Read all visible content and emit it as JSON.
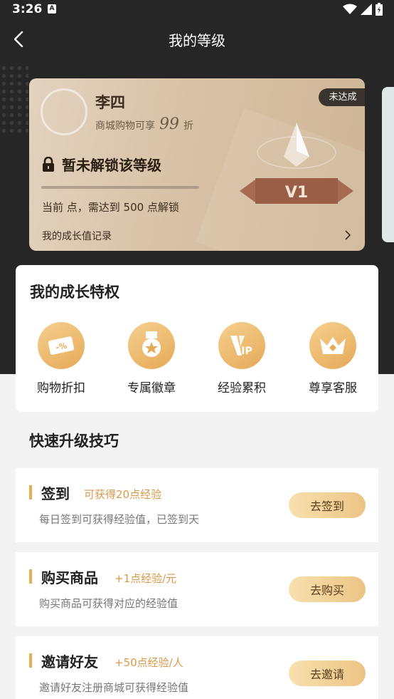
{
  "status_bar": {
    "time": "3:26",
    "notif_letter": "A"
  },
  "header": {
    "title": "我的等级"
  },
  "level_card": {
    "user_name": "李四",
    "discount_prefix": "商城购物可享",
    "discount_value": "99",
    "discount_suffix": "折",
    "badge": "未达成",
    "lock_text": "暂未解锁该等级",
    "unlock_hint": "当前  点，需达到 500 点解锁",
    "record_link": "我的成长值记录",
    "level_label": "V1",
    "progress": 0
  },
  "privileges": {
    "title": "我的成长特权",
    "items": [
      {
        "label": "购物折扣",
        "icon": "discount-icon"
      },
      {
        "label": "专属徽章",
        "icon": "badge-icon"
      },
      {
        "label": "经验累积",
        "icon": "vip-icon"
      },
      {
        "label": "尊享客服",
        "icon": "crown-icon"
      }
    ]
  },
  "tips": {
    "title": "快速升级技巧",
    "items": [
      {
        "title": "签到",
        "reward": "可获得20点经验",
        "desc": "每日签到可获得经验值，已签到天",
        "button": "去签到"
      },
      {
        "title": "购买商品",
        "reward": "+1点经验/元",
        "desc": "购买商品可获得对应的经验值",
        "button": "去购买"
      },
      {
        "title": "邀请好友",
        "reward": "+50点经验/人",
        "desc": "邀请好友注册商城可获得经验值",
        "button": "去邀请"
      }
    ]
  },
  "colors": {
    "dark_bg": "#262626",
    "gold_accent": "#e6ad55",
    "page_bg": "#f3f3f4"
  }
}
